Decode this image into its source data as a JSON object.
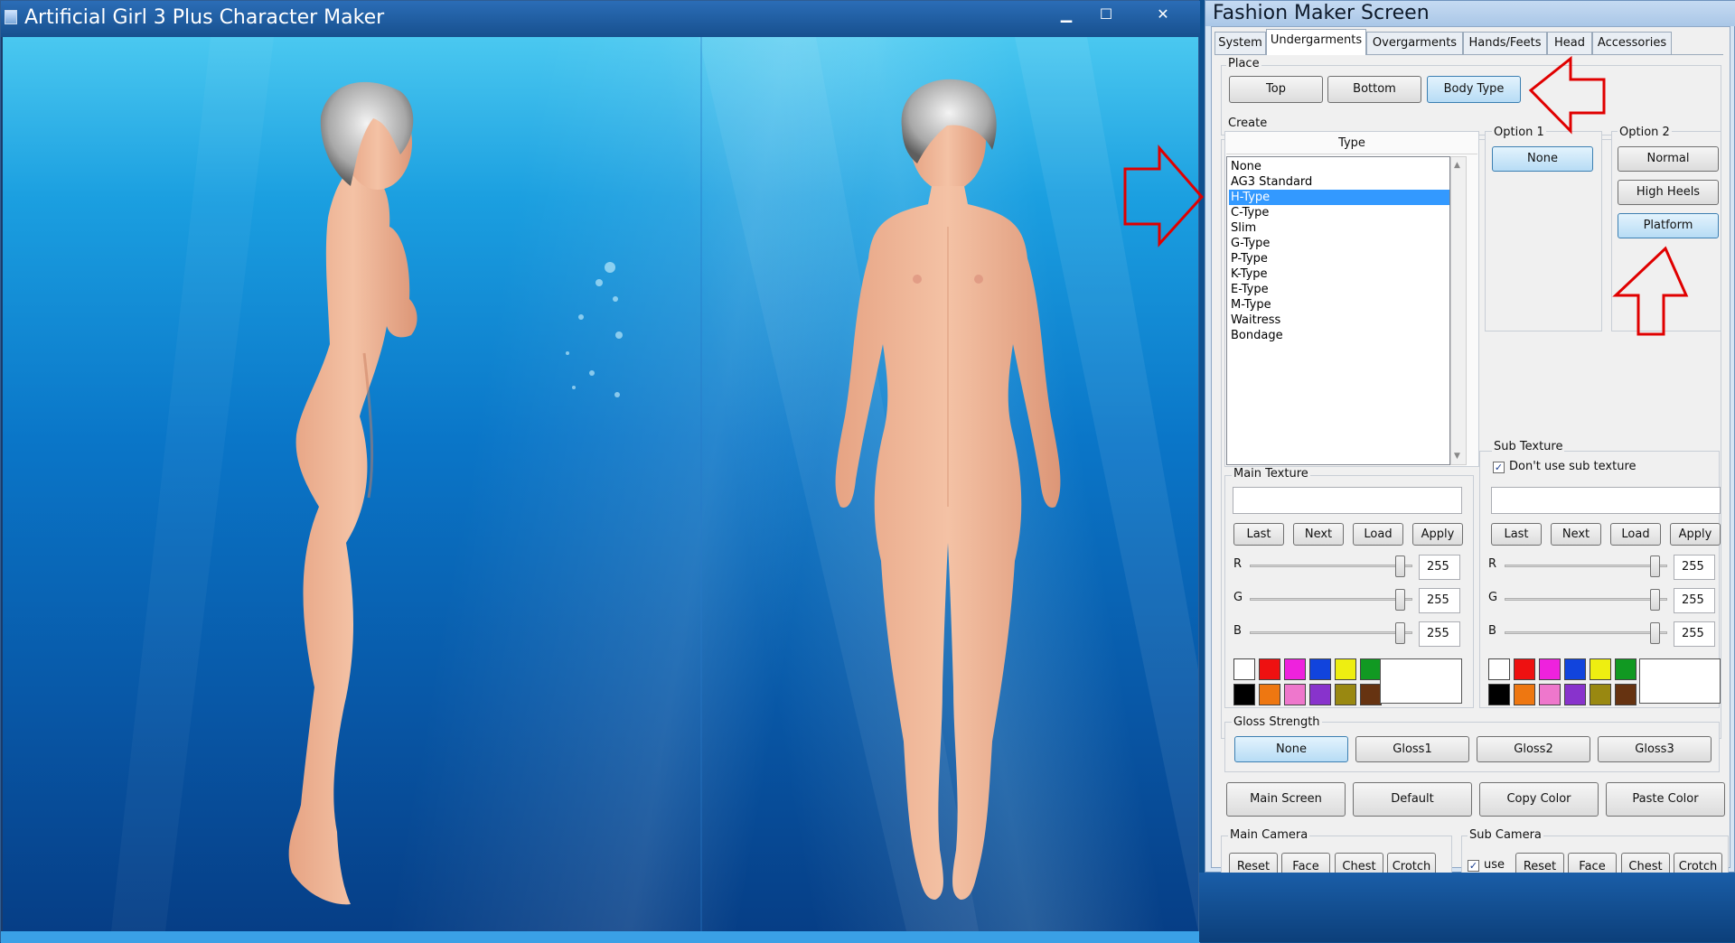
{
  "main_window": {
    "title": "Artificial Girl 3 Plus Character Maker",
    "minimize": "▁",
    "maximize": "☐",
    "close": "✕"
  },
  "panel": {
    "title": "Fashion Maker Screen",
    "tabs": [
      "System",
      "Undergarments",
      "Overgarments",
      "Hands/Feets",
      "Head",
      "Accessories"
    ],
    "active_tab": "Undergarments",
    "place": {
      "label": "Place",
      "buttons": [
        "Top",
        "Bottom",
        "Body Type"
      ],
      "selected": "Body Type"
    },
    "create": {
      "label": "Create",
      "type_header": "Type",
      "types": [
        "None",
        "AG3 Standard",
        "H-Type",
        "C-Type",
        "Slim",
        "G-Type",
        "P-Type",
        "K-Type",
        "E-Type",
        "M-Type",
        "Waitress",
        "Bondage"
      ],
      "selected_type": "H-Type"
    },
    "option1": {
      "label": "Option 1",
      "buttons": [
        "None"
      ],
      "selected": "None"
    },
    "option2": {
      "label": "Option 2",
      "buttons": [
        "Normal",
        "High Heels",
        "Platform"
      ],
      "selected": "Platform"
    },
    "main_texture": {
      "label": "Main Texture",
      "value": "",
      "buttons": [
        "Last",
        "Next",
        "Load",
        "Apply"
      ],
      "r_label": "R",
      "g_label": "G",
      "b_label": "B",
      "r": "255",
      "g": "255",
      "b": "255"
    },
    "sub_texture": {
      "label": "Sub Texture",
      "dont_use_label": "Don't use sub texture",
      "dont_use_checked": true,
      "value": "",
      "buttons": [
        "Last",
        "Next",
        "Load",
        "Apply"
      ],
      "r_label": "R",
      "g_label": "G",
      "b_label": "B",
      "r": "255",
      "g": "255",
      "b": "255"
    },
    "swatches": {
      "row1": [
        "#ffffff",
        "#ee1111",
        "#ee22dd",
        "#1144dd",
        "#eeee11",
        "#119922"
      ],
      "row2": [
        "#000000",
        "#ee7711",
        "#ee77cc",
        "#8833cc",
        "#998811",
        "#663311"
      ],
      "preview": "#ffffff"
    },
    "gloss": {
      "label": "Gloss Strength",
      "buttons": [
        "None",
        "Gloss1",
        "Gloss2",
        "Gloss3"
      ],
      "selected": "None"
    },
    "actions": [
      "Main Screen",
      "Default",
      "Copy Color",
      "Paste Color"
    ],
    "main_camera": {
      "label": "Main Camera",
      "buttons": [
        "Reset",
        "Face",
        "Chest",
        "Crotch"
      ]
    },
    "sub_camera": {
      "label": "Sub Camera",
      "use_label": "use",
      "use_checked": true,
      "buttons": [
        "Reset",
        "Face",
        "Chest",
        "Crotch"
      ]
    }
  },
  "colors": {
    "selected_button": "#b7dcf5",
    "list_selection": "#3399ff",
    "annotation_arrow": "#e00000",
    "title_bar": "#17508f"
  }
}
